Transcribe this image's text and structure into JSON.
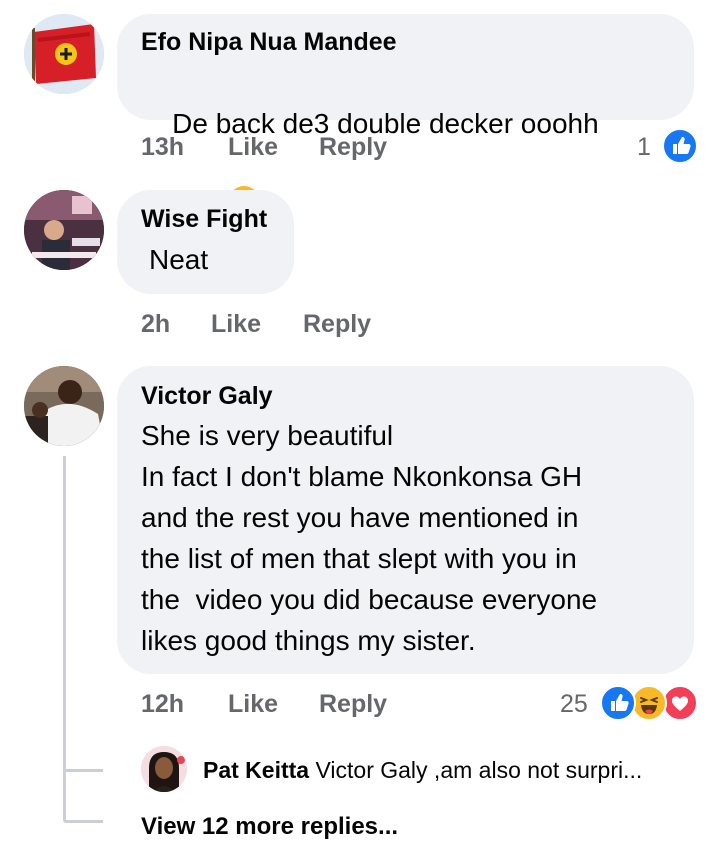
{
  "comments": [
    {
      "author": "Efo Nipa Nua Mandee",
      "text": "De back de3 double decker ooohh",
      "time": "13h",
      "like_label": "Like",
      "reply_label": "Reply",
      "reaction_count": "1"
    },
    {
      "author": "Wise Fight",
      "text": "Neat",
      "time": "2h",
      "like_label": "Like",
      "reply_label": "Reply"
    },
    {
      "author": "Victor Galy",
      "lines": [
        "She is very beautiful",
        "In fact I don't blame Nkonkonsa GH",
        "and the rest you have mentioned in",
        "the list of men that slept with you in",
        "the  video you did because everyone",
        "likes good things my sister."
      ],
      "time": "12h",
      "like_label": "Like",
      "reply_label": "Reply",
      "reaction_count": "25"
    }
  ],
  "reply_preview": {
    "author": "Pat Keitta",
    "text": "Victor Galy ,am also not surpri..."
  },
  "view_more": "View 12 more replies...",
  "colors": {
    "bubble": "#f0f2f5",
    "meta": "#65676b",
    "like_blue": "#1877f2",
    "love_red": "#f33e58",
    "haha_yellow": "#f7b928"
  },
  "icons": [
    "flag-avatar",
    "slightly-smiling-emoji-icon",
    "thumbs-up-icon",
    "haha-icon",
    "love-icon"
  ]
}
